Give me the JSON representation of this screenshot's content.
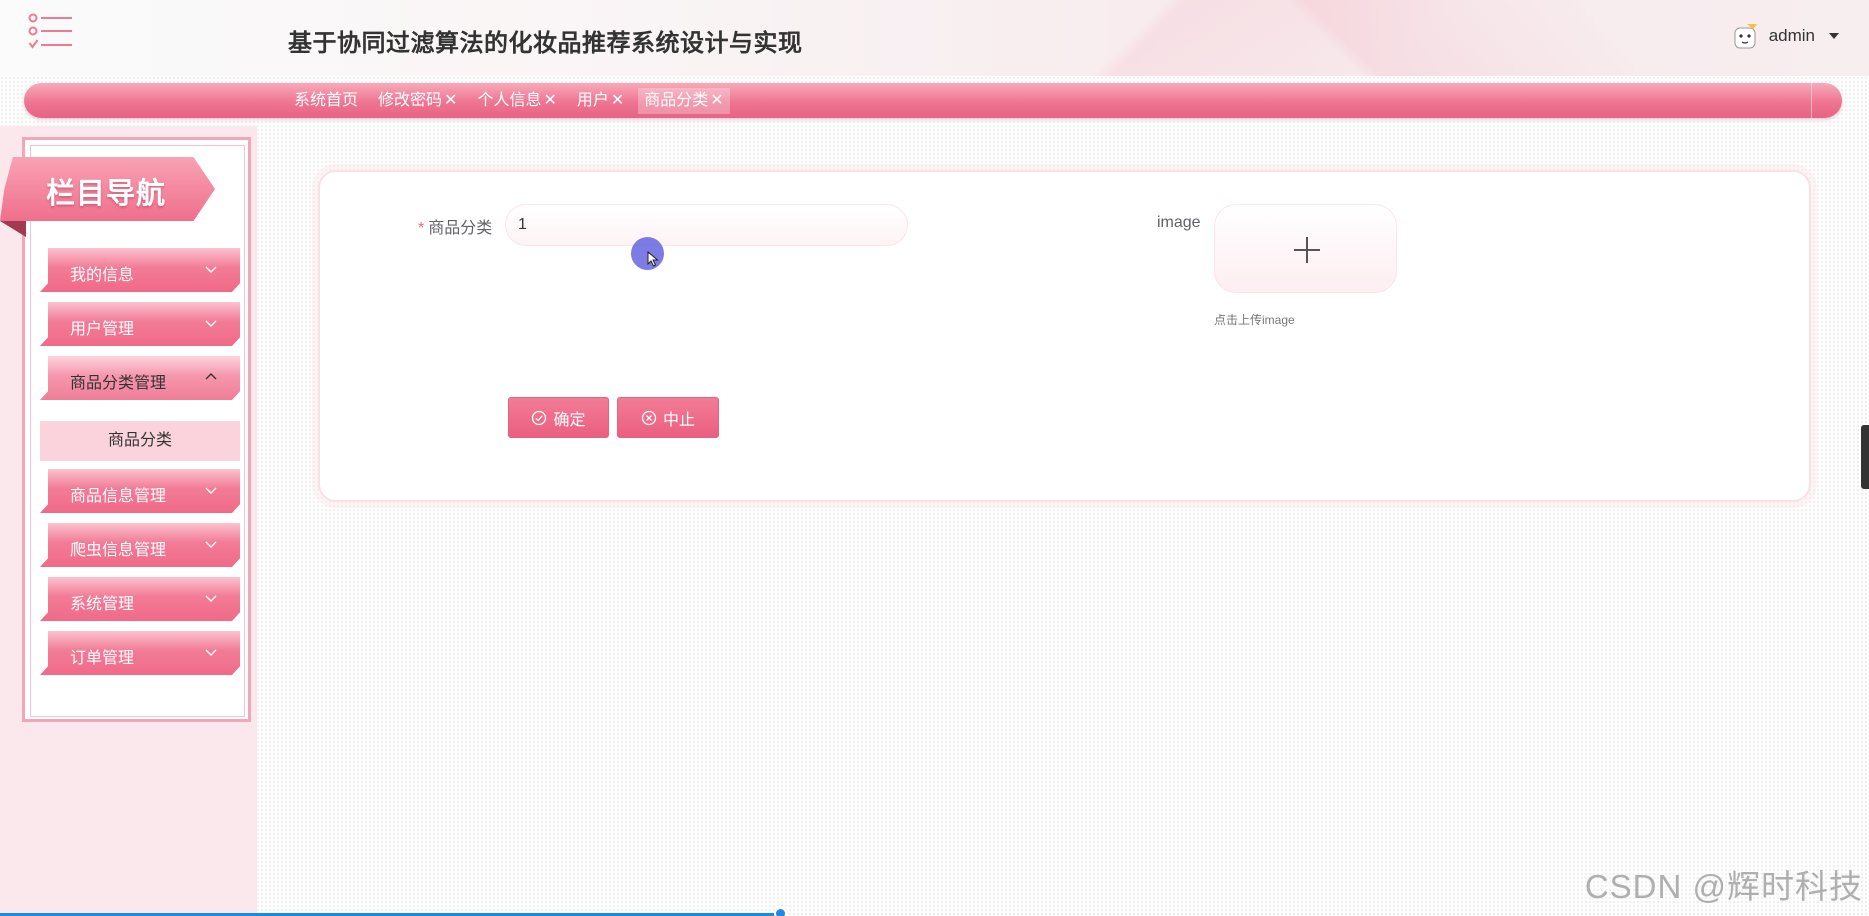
{
  "header": {
    "title": "基于协同过滤算法的化妆品推荐系统设计与实现",
    "user": "admin"
  },
  "tabs": [
    {
      "label": "系统首页",
      "closable": false
    },
    {
      "label": "修改密码",
      "closable": true
    },
    {
      "label": "个人信息",
      "closable": true
    },
    {
      "label": "用户",
      "closable": true
    },
    {
      "label": "商品分类",
      "closable": true,
      "active": true
    }
  ],
  "tab_close": "✕",
  "sidebar": {
    "title": "栏目导航",
    "items": [
      {
        "label": "我的信息"
      },
      {
        "label": "用户管理"
      },
      {
        "label": "商品分类管理",
        "open": true
      },
      {
        "label": "商品信息管理"
      },
      {
        "label": "爬虫信息管理"
      },
      {
        "label": "系统管理"
      },
      {
        "label": "订单管理"
      }
    ],
    "submenu": {
      "label": "商品分类"
    }
  },
  "form": {
    "required_mark": "*",
    "category_label": "商品分类",
    "category_value": "1",
    "image_label": "image",
    "upload_tip": "点击上传image",
    "confirm_label": "确定",
    "cancel_label": "中止"
  },
  "watermark": "CSDN @辉时科技",
  "colors": {
    "accent": "#ee7592",
    "accent_dark": "#eb5f80",
    "sidebar_bg": "#fbe8ec"
  }
}
